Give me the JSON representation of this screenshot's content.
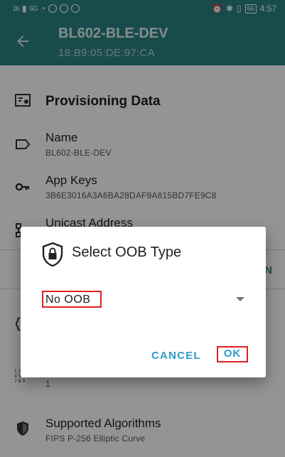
{
  "status_bar": {
    "signal_1": "26",
    "signal_2": "5G",
    "battery": "66",
    "time": "4:57"
  },
  "app_bar": {
    "back_icon": "arrow-back-icon",
    "title": "BL602-BLE-DEV",
    "subtitle": "18:B9:05:DE:97:CA"
  },
  "provisioning": {
    "section_title": "Provisioning Data",
    "name_label": "Name",
    "name_value": "BL602-BLE-DEV",
    "app_keys_label": "App Keys",
    "app_keys_value": "3B6E3016A3A6BA28DAF9A815BD7FE9C8",
    "unicast_label": "Unicast Address",
    "edge_button_fragment": "N"
  },
  "capabilities": {
    "partial_value": "1",
    "supported_algorithms_label": "Supported Algorithms",
    "supported_algorithms_value": "FIPS P-256 Elliptic Curve"
  },
  "dialog": {
    "icon": "lock-shield-icon",
    "title": "Select OOB Type",
    "selected_option": "No OOB",
    "cancel_label": "CANCEL",
    "ok_label": "OK"
  },
  "colors": {
    "primary": "#2a8383",
    "accent_button": "#2a9dc8",
    "highlight_box": "#e02020"
  }
}
